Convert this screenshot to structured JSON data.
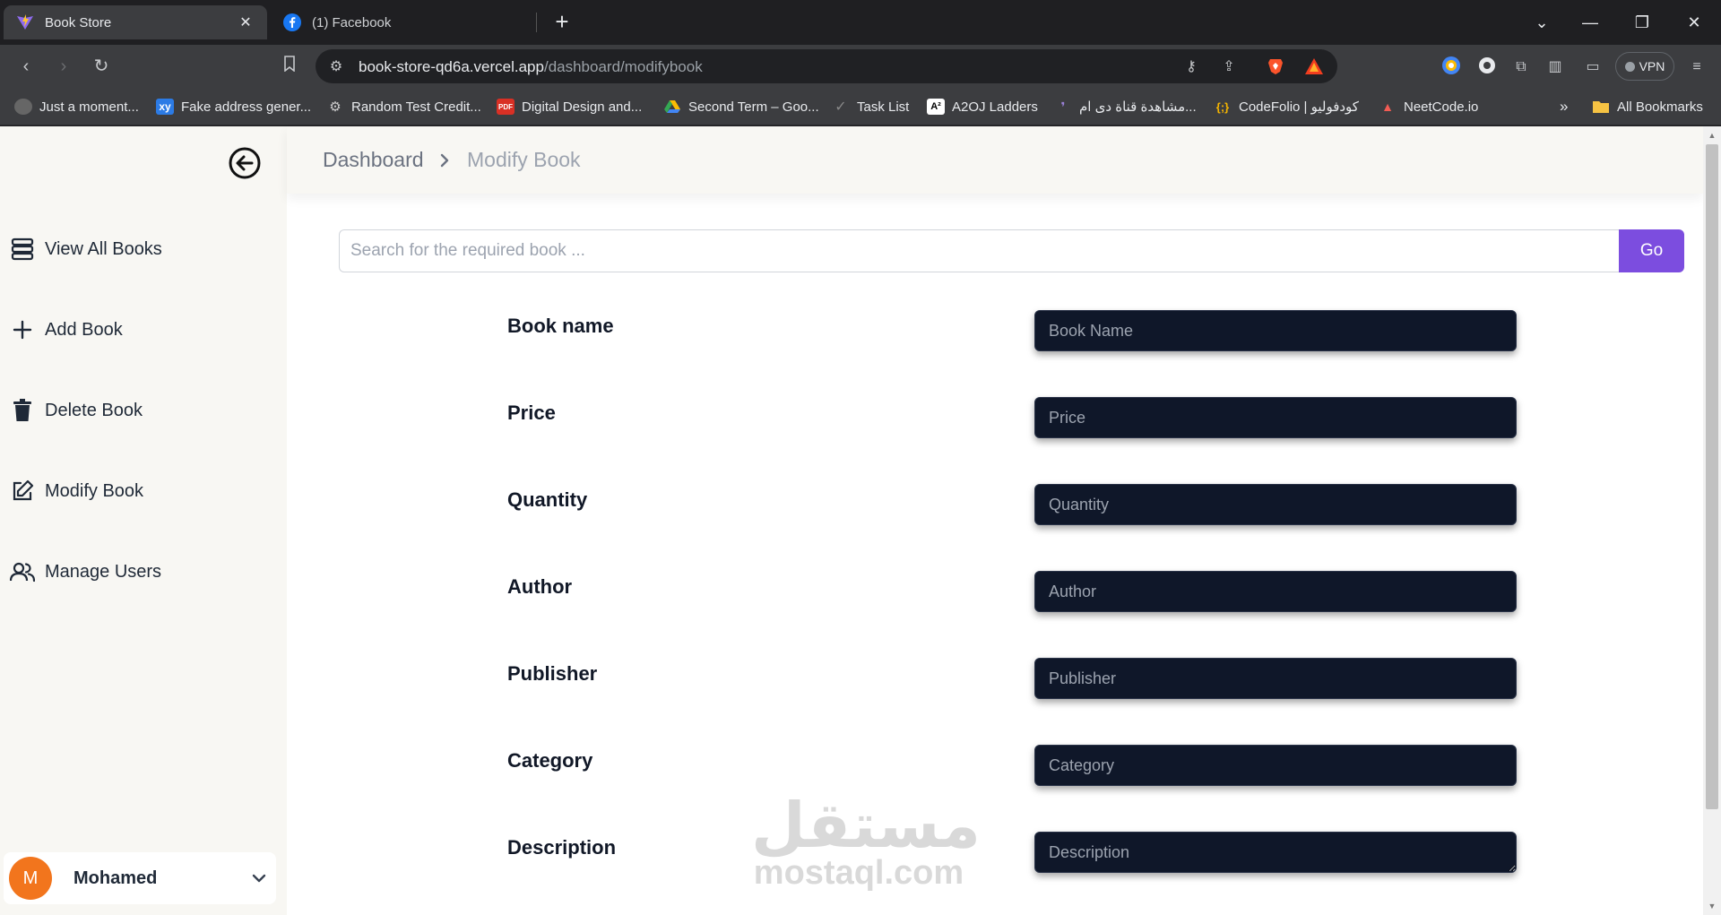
{
  "browser": {
    "tabs": [
      {
        "title": "Book Store",
        "icon": "vite-icon",
        "active": true
      },
      {
        "title": "(1) Facebook",
        "icon": "facebook-icon",
        "active": false
      }
    ],
    "url": {
      "host": "book-store-qd6a.vercel.app",
      "path": "/dashboard/modifybook"
    },
    "vpn_label": "VPN",
    "bookmarks": [
      {
        "label": "Just a moment...",
        "icon": "site-icon"
      },
      {
        "label": "Fake address gener...",
        "icon": "xy-icon"
      },
      {
        "label": "Random Test Credit...",
        "icon": "gear-icon"
      },
      {
        "label": "Digital Design and...",
        "icon": "pdf-icon"
      },
      {
        "label": "Second Term – Goo...",
        "icon": "drive-icon"
      },
      {
        "label": "Task List",
        "icon": "check-icon"
      },
      {
        "label": "A2OJ Ladders",
        "icon": "a2oj-icon"
      },
      {
        "label": "مشاهدة قناة دى ام...",
        "icon": "site-icon"
      },
      {
        "label": "CodeFolio | كودفوليو",
        "icon": "codefolio-icon"
      },
      {
        "label": "NeetCode.io",
        "icon": "rocket-icon"
      }
    ],
    "all_bookmarks_label": "All Bookmarks",
    "overflow_label": "»"
  },
  "sidebar": {
    "items": [
      {
        "label": "View All Books",
        "icon": "stack-icon"
      },
      {
        "label": "Add Book",
        "icon": "plus-icon"
      },
      {
        "label": "Delete Book",
        "icon": "trash-icon"
      },
      {
        "label": "Modify Book",
        "icon": "edit-icon"
      },
      {
        "label": "Manage Users",
        "icon": "users-icon"
      }
    ],
    "user": {
      "initial": "M",
      "name": "Mohamed",
      "avatar_color": "#f2751d"
    }
  },
  "header": {
    "breadcrumb_root": "Dashboard",
    "breadcrumb_current": "Modify Book"
  },
  "search": {
    "placeholder": "Search for the required book ...",
    "button_label": "Go",
    "button_color": "#7c4ddf"
  },
  "form": {
    "fields": [
      {
        "label": "Book name",
        "placeholder": "Book Name"
      },
      {
        "label": "Price",
        "placeholder": "Price"
      },
      {
        "label": "Quantity",
        "placeholder": "Quantity"
      },
      {
        "label": "Author",
        "placeholder": "Author"
      },
      {
        "label": "Publisher",
        "placeholder": "Publisher"
      },
      {
        "label": "Category",
        "placeholder": "Category"
      },
      {
        "label": "Description",
        "placeholder": "Description"
      }
    ],
    "field_color": "#0f1729"
  },
  "watermark": {
    "arabic": "مستقل",
    "latin": "mostaql.com"
  }
}
